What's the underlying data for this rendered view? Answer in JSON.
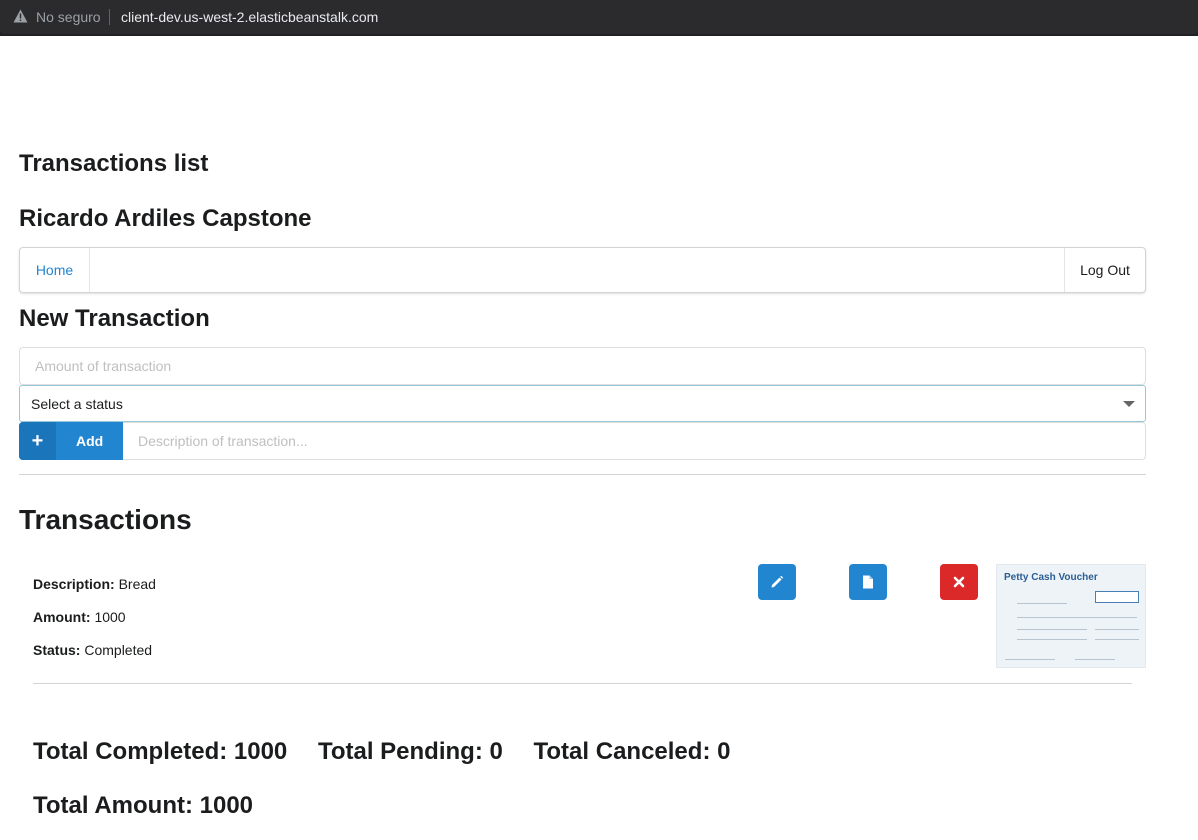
{
  "browser": {
    "security_label": "No seguro",
    "url": "client-dev.us-west-2.elasticbeanstalk.com"
  },
  "header": {
    "title": "Transactions list",
    "subtitle": "Ricardo Ardiles Capstone"
  },
  "menu": {
    "home_label": "Home",
    "logout_label": "Log Out"
  },
  "new_transaction": {
    "heading": "New Transaction",
    "amount_placeholder": "Amount of transaction",
    "status_select_value": "Select a status",
    "add_label": "Add",
    "add_icon": "+",
    "description_placeholder": "Description of transaction..."
  },
  "transactions": {
    "heading": "Transactions",
    "items": [
      {
        "description_label": "Description:",
        "description": "Bread",
        "amount_label": "Amount:",
        "amount": "1000",
        "status_label": "Status:",
        "status": "Completed",
        "attachment_title": "Petty Cash Voucher"
      }
    ]
  },
  "totals": {
    "completed": "Total Completed: 1000",
    "pending": "Total Pending: 0",
    "canceled": "Total Canceled: 0",
    "amount": "Total Amount: 1000"
  },
  "colors": {
    "primary": "#2185d0",
    "danger": "#db2828",
    "link": "#2185d0"
  },
  "icons": {
    "edit": "pencil-icon",
    "file": "file-icon",
    "delete": "close-icon",
    "warning": "warning-icon"
  }
}
